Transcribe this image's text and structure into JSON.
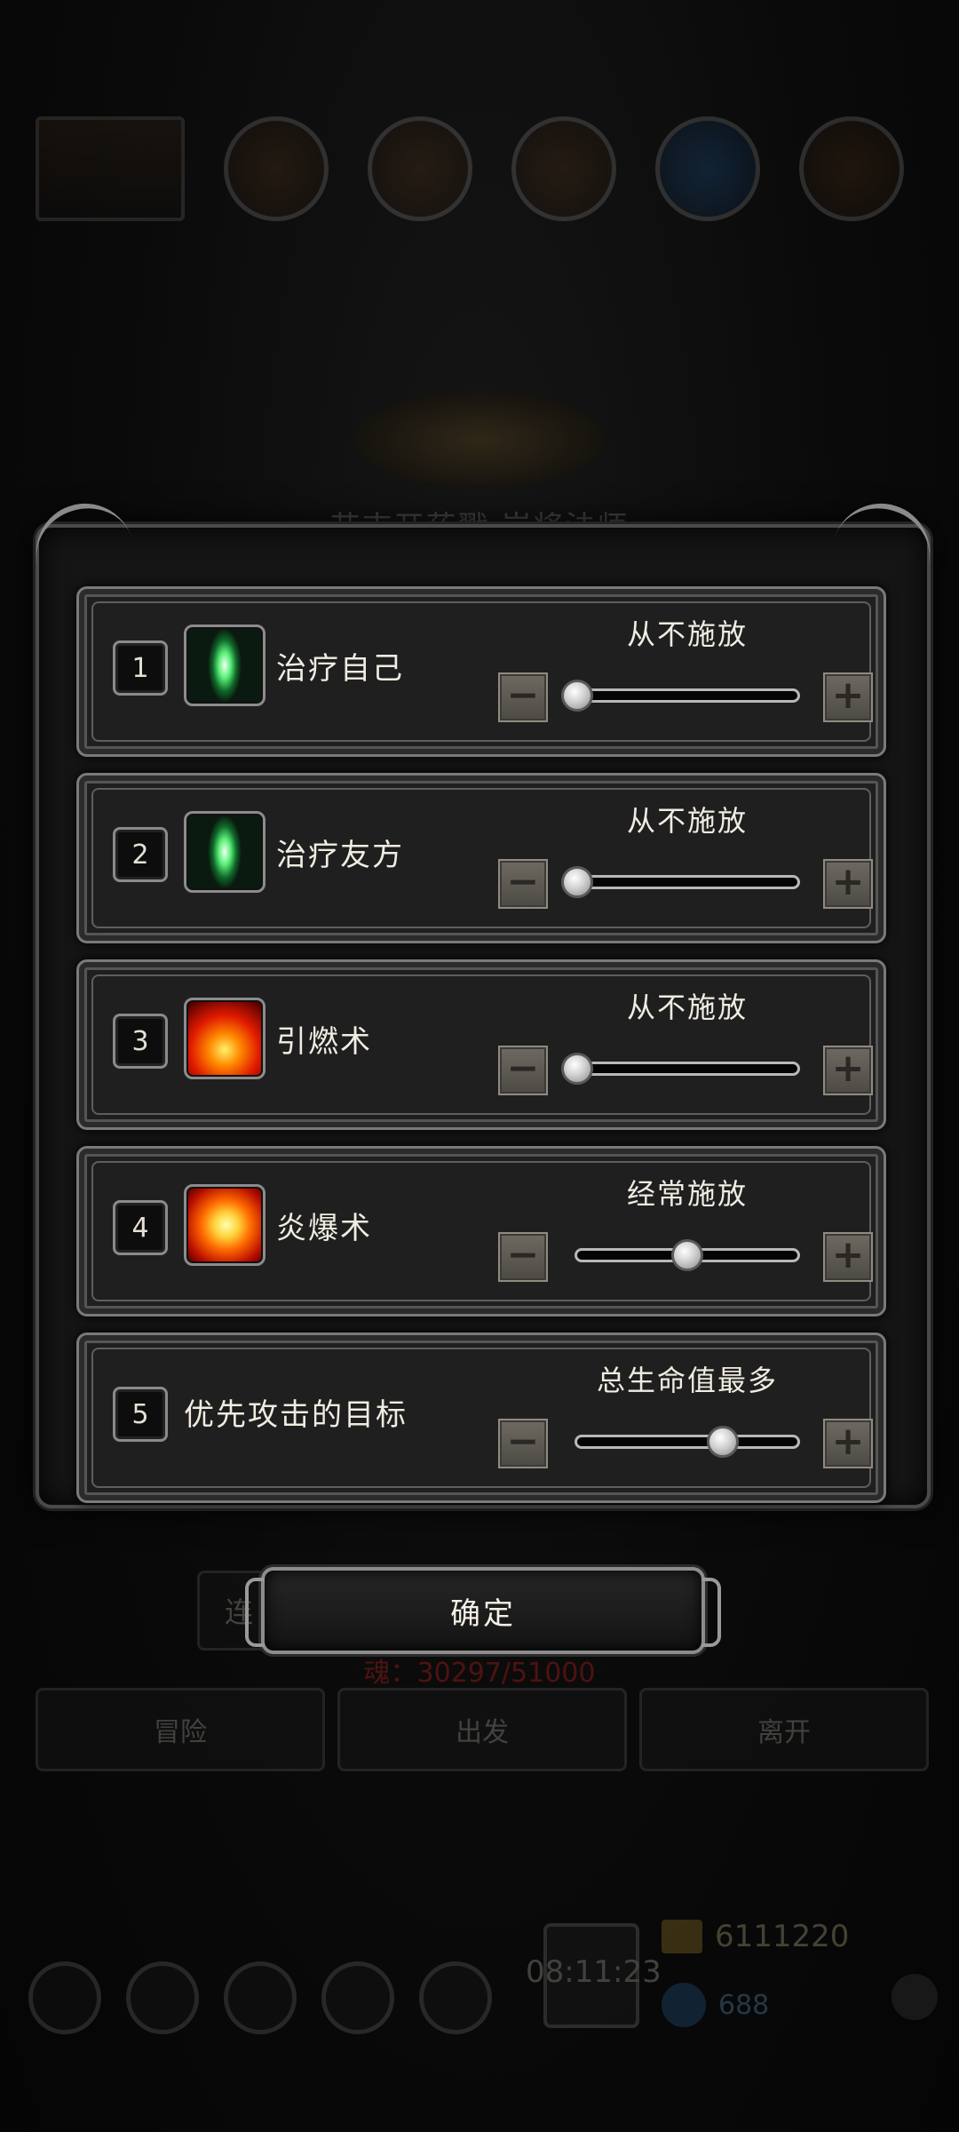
{
  "background": {
    "title": "艾吉开药戳 岸将法师",
    "left_button": "连",
    "soul_text": "魂：30297/51000",
    "nav": [
      "冒险",
      "出发",
      "离开"
    ],
    "timer": "08:11:23",
    "gold": "6111220",
    "gems": "688"
  },
  "dialog": {
    "rows": [
      {
        "number": "1",
        "icon": "green-crystal-icon",
        "name": "治疗自己",
        "setting": "从不施放",
        "level": 0.0
      },
      {
        "number": "2",
        "icon": "green-crystal-icon",
        "name": "治疗友方",
        "setting": "从不施放",
        "level": 0.0
      },
      {
        "number": "3",
        "icon": "fire-icon",
        "name": "引燃术",
        "setting": "从不施放",
        "level": 0.0
      },
      {
        "number": "4",
        "icon": "explosion-icon",
        "name": "炎爆术",
        "setting": "经常施放",
        "level": 0.5
      },
      {
        "number": "5",
        "icon": "",
        "name": "优先攻击的目标",
        "setting": "总生命值最多",
        "level": 0.66
      }
    ],
    "minus_label": "−",
    "plus_label": "+"
  },
  "confirm_label": "确定",
  "colors": {
    "panel": "#1f1f1f",
    "frame": "#7a7a7a",
    "text": "#f0ece2",
    "soul_red": "#ff2a2a"
  }
}
